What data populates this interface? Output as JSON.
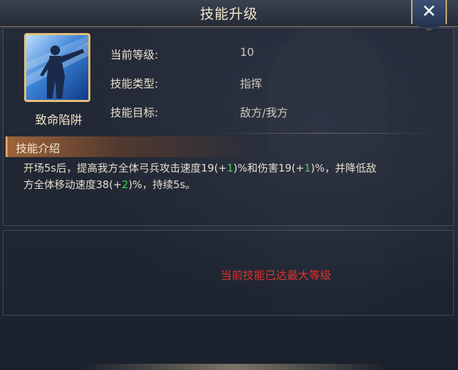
{
  "window": {
    "title": "技能升级",
    "close_icon": "close-icon"
  },
  "skill": {
    "name": "致命陷阱",
    "icon": "soldier-pointing-icon"
  },
  "info": {
    "level_label": "当前等级:",
    "level_value": "10",
    "type_label": "技能类型:",
    "type_value": "指挥",
    "target_label": "技能目标:",
    "target_value": "敌方/我方"
  },
  "section": {
    "title": "技能介绍"
  },
  "description": {
    "p1": "开场5s后，提高我方全体弓兵攻击速度19(+",
    "g1": "1",
    "p2": ")%和伤害19(+",
    "g2": "1",
    "p3": ")%，并降低敌",
    "p4": "方全体移动速度38(+",
    "g3": "2",
    "p5": ")%，持续5s。"
  },
  "status": {
    "max_level_text": "当前技能已达最大等级"
  },
  "colors": {
    "highlight_green": "#45d24a",
    "warning_red": "#e0302a",
    "gold_frame": "#e6c07a"
  }
}
